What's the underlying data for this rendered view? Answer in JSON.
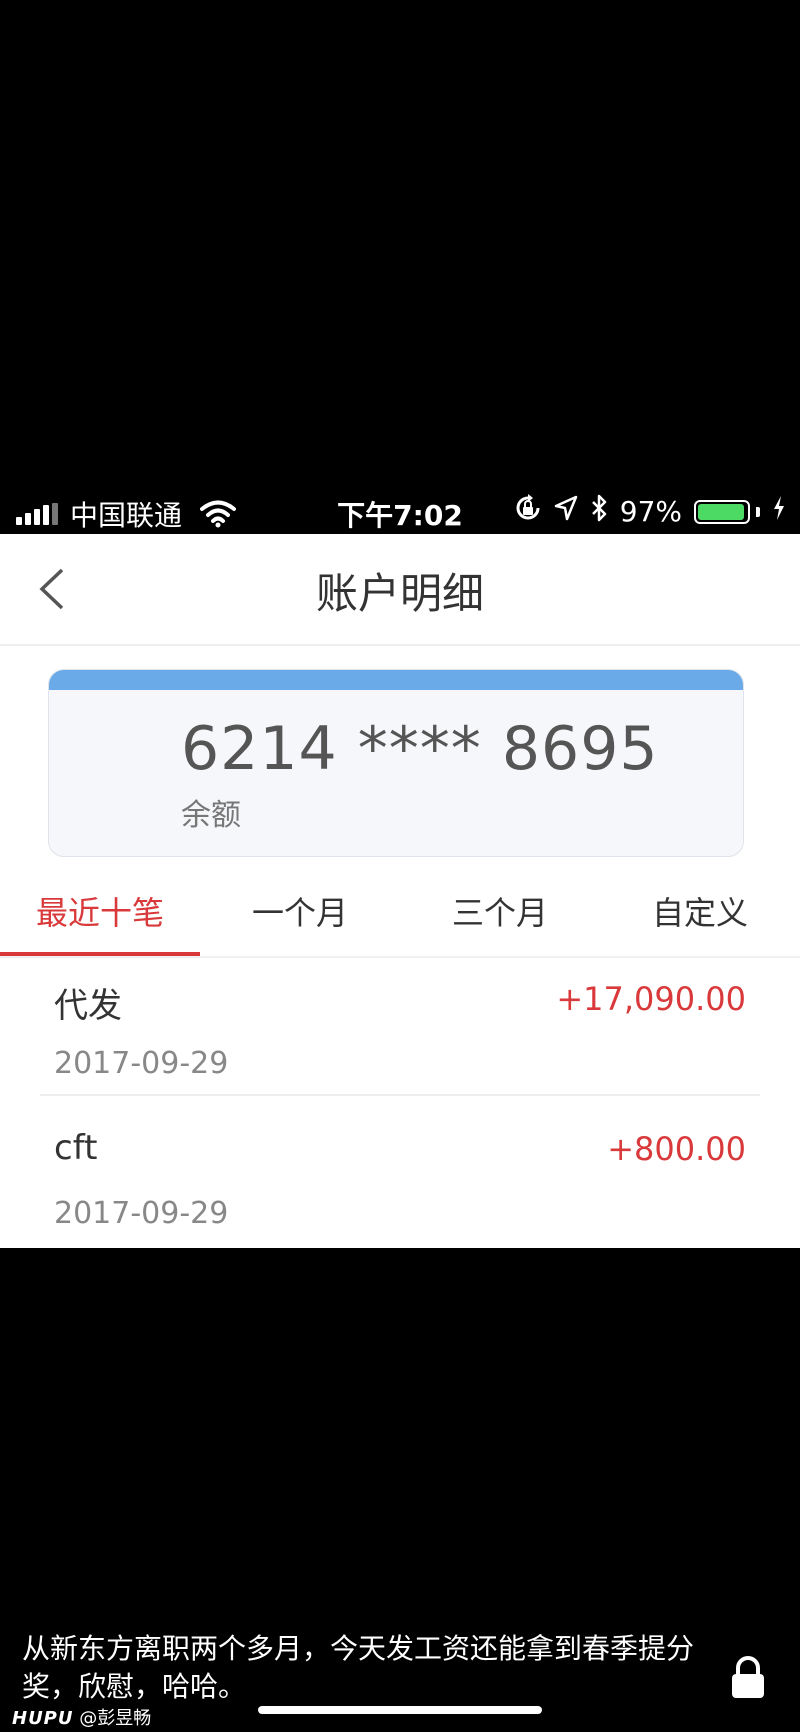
{
  "status_bar": {
    "carrier": "中国联通",
    "time": "下午7:02",
    "battery_percent": "97%",
    "battery_level": 0.97,
    "icons": [
      "signal-icon",
      "wifi-icon",
      "rotation-lock-icon",
      "location-icon",
      "bluetooth-icon",
      "battery-icon",
      "charging-icon"
    ]
  },
  "nav": {
    "title": "账户明细",
    "back_icon": "chevron-left-icon"
  },
  "card": {
    "number": "6214 **** 8695",
    "balance_label": "余额",
    "accent_color": "#6aaae8"
  },
  "tabs": [
    {
      "label": "最近十笔",
      "active": true
    },
    {
      "label": "一个月",
      "active": false
    },
    {
      "label": "三个月",
      "active": false
    },
    {
      "label": "自定义",
      "active": false
    }
  ],
  "transactions": [
    {
      "desc": "代发",
      "amount": "+17,090.00",
      "date": "2017-09-29"
    },
    {
      "desc": "cft",
      "amount": "+800.00",
      "date": "2017-09-29"
    }
  ],
  "caption": {
    "text": "从新东方离职两个多月，今天发工资还能拿到春季提分奖，欣慰，哈哈。",
    "lock_icon": "lock-icon"
  },
  "watermark": {
    "brand": "HUPU",
    "user": "@彭昱畅"
  },
  "colors": {
    "accent_red": "#d9393a",
    "battery_green": "#4cd964"
  }
}
